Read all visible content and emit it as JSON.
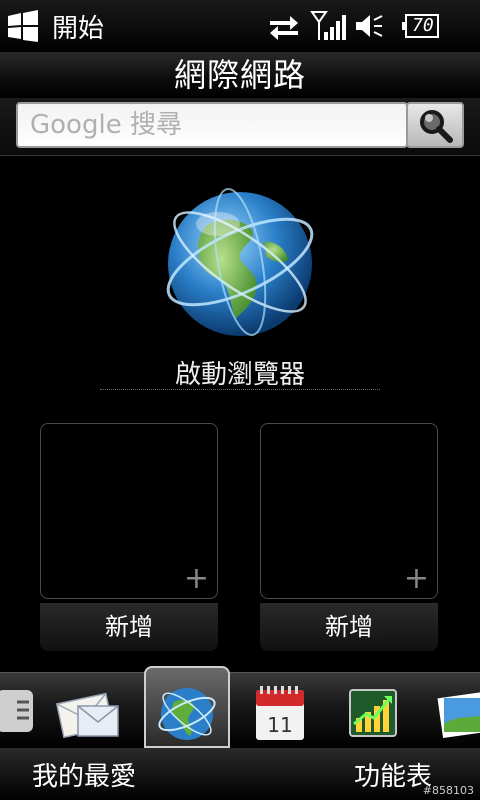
{
  "status_bar": {
    "start_label": "開始",
    "battery_level": "70",
    "icons": [
      "windows-logo-icon",
      "sync-arrows-icon",
      "signal-icon",
      "volume-icon",
      "battery-icon"
    ]
  },
  "page": {
    "title": "網際網路"
  },
  "search": {
    "placeholder": "Google 搜尋",
    "button_icon": "magnifier-icon"
  },
  "browser": {
    "icon": "globe-icon",
    "launch_label": "啟動瀏覽器"
  },
  "tiles": [
    {
      "label": "新增"
    },
    {
      "label": "新增"
    }
  ],
  "tab_strip": {
    "tabs": [
      "menu-partial-icon",
      "mail-icon",
      "internet-globe-icon",
      "calendar-icon",
      "stocks-icon",
      "photos-icon"
    ],
    "selected": "internet-globe-icon",
    "calendar_day": "11"
  },
  "soft_keys": {
    "left": "我的最愛",
    "right": "功能表"
  },
  "watermark": "#858103",
  "colors": {
    "background": "#000000",
    "search_field": "#ffffff",
    "tab_selected_border": "#cfcfcf"
  }
}
